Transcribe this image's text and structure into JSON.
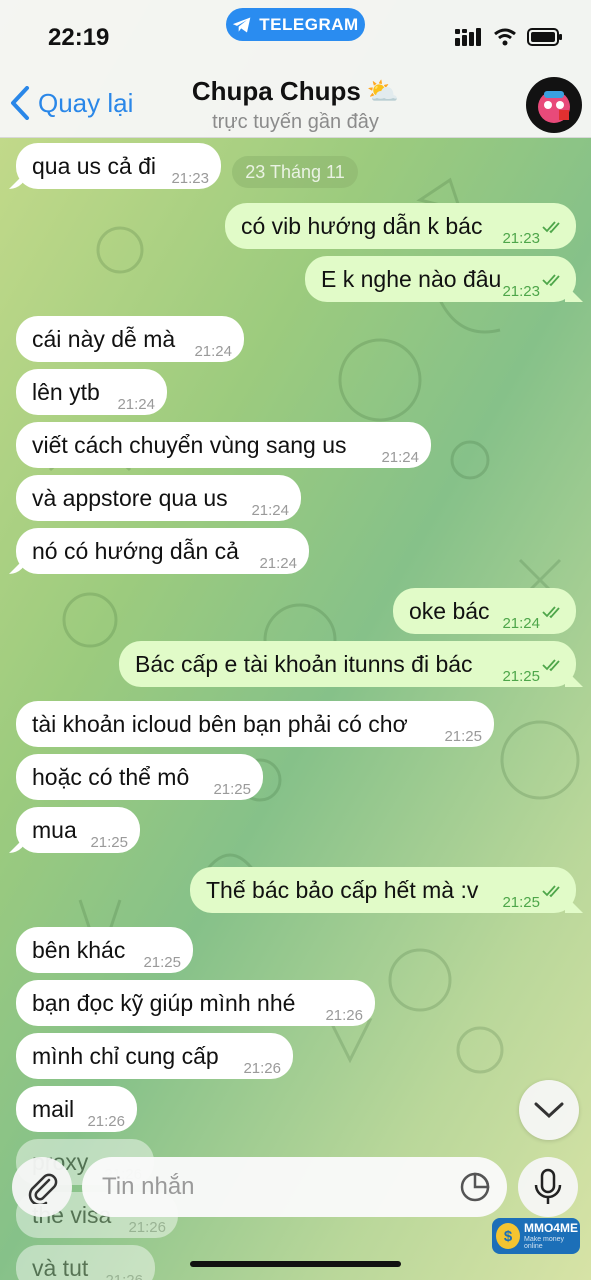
{
  "status_bar": {
    "time": "22:19",
    "pill_label": "TELEGRAM"
  },
  "header": {
    "back_label": "Quay lại",
    "chat_title": "Chupa Chups",
    "title_emoji": "⛅",
    "subtitle": "trực tuyến gần đây"
  },
  "date_separator": "23 Tháng 11",
  "messages": [
    {
      "dir": "in",
      "text": "qua us cả đi",
      "time": "21:23"
    },
    {
      "dir": "out",
      "text": "có vib hướng dẫn k bác",
      "time": "21:23"
    },
    {
      "dir": "out",
      "text": "E k nghe nào đâu",
      "time": "21:23"
    },
    {
      "dir": "in",
      "text": "cái này dễ mà",
      "time": "21:24"
    },
    {
      "dir": "in",
      "text": "lên ytb",
      "time": "21:24"
    },
    {
      "dir": "in",
      "text": "viết cách chuyển vùng sang us",
      "time": "21:24"
    },
    {
      "dir": "in",
      "text": "và appstore qua us",
      "time": "21:24"
    },
    {
      "dir": "in",
      "text": "nó có hướng dẫn cả",
      "time": "21:24"
    },
    {
      "dir": "out",
      "text": "oke bác",
      "time": "21:24"
    },
    {
      "dir": "out",
      "text": "Bác cấp e tài khoản itunns đi bác",
      "time": "21:25"
    },
    {
      "dir": "in",
      "text": "tài khoản icloud bên bạn phải có chơ",
      "time": "21:25"
    },
    {
      "dir": "in",
      "text": "hoặc có thể mô",
      "time": "21:25"
    },
    {
      "dir": "in",
      "text": "mua",
      "time": "21:25"
    },
    {
      "dir": "out",
      "text": "Thế bác bảo cấp hết mà :v",
      "time": "21:25"
    },
    {
      "dir": "in",
      "text": "bên khác",
      "time": "21:25"
    },
    {
      "dir": "in",
      "text": "bạn đọc kỹ giúp mình nhé",
      "time": "21:26"
    },
    {
      "dir": "in",
      "text": "mình chỉ cung cấp",
      "time": "21:26"
    },
    {
      "dir": "in",
      "text": "mail",
      "time": "21:26"
    },
    {
      "dir": "in",
      "text": "proxy",
      "time": "21:26"
    },
    {
      "dir": "in",
      "text": "the visa",
      "time": "21:26"
    },
    {
      "dir": "in",
      "text": "và tut",
      "time": "21:26"
    }
  ],
  "composer": {
    "placeholder": "Tin nhắn"
  },
  "watermark": {
    "brand": "MMO4ME",
    "tagline": "Make money online"
  },
  "colors": {
    "accent": "#2a87e8",
    "outgoing_bubble": "#e1fbc8",
    "incoming_bubble": "#ffffff",
    "check": "#4ea64a"
  }
}
